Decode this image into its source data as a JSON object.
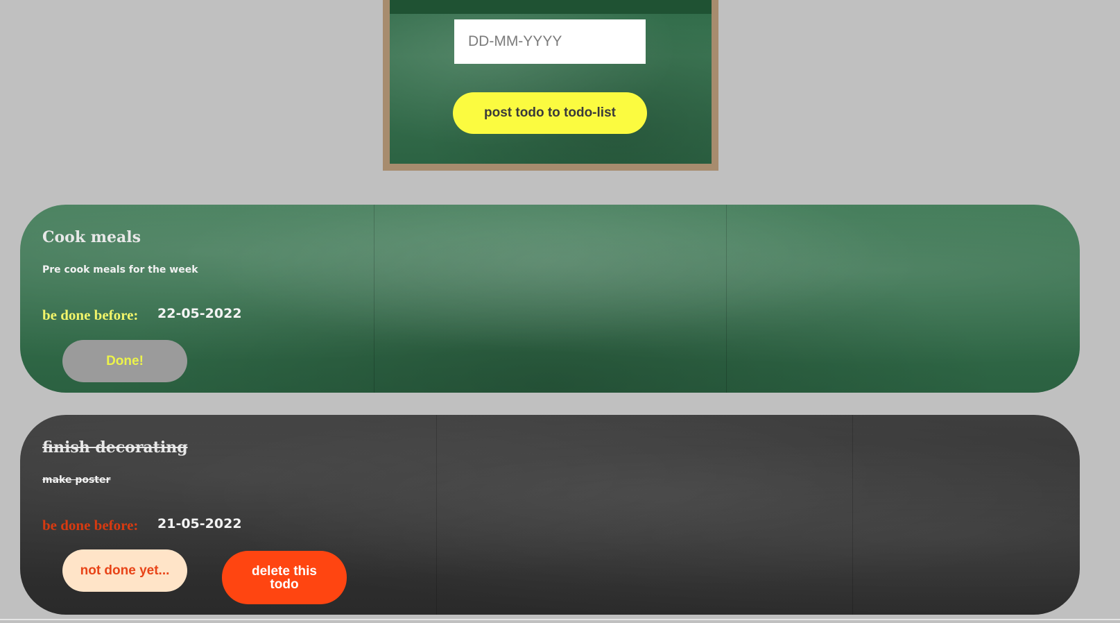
{
  "form": {
    "date_placeholder": "DD-MM-YYYY",
    "date_value": "",
    "post_button_label": "post todo to todo-list"
  },
  "todos": [
    {
      "title": "Cook meals",
      "description": "Pre cook meals for the week",
      "due_label": "be done before:",
      "due_date": "22-05-2022",
      "status": "not-done",
      "toggle_label": "Done!"
    },
    {
      "title": "finish decorating",
      "description": "make poster",
      "due_label": "be done before:",
      "due_date": "21-05-2022",
      "status": "done",
      "toggle_label": "not done yet...",
      "delete_label": "delete this todo"
    }
  ],
  "colors": {
    "page_background": "#c0c0c0",
    "board_frame": "#a78c6e",
    "chalkboard_green": "#346e4b",
    "chalkboard_black": "#333333",
    "post_button": "#fbfb40",
    "done_button": "#9b9b9b",
    "done_button_text": "#ecf34a",
    "not_done_button": "#ffe4c8",
    "not_done_button_text": "#e84317",
    "delete_button": "#ff4511",
    "due_label_active": "#f2f56a",
    "due_label_done": "#d83a10"
  }
}
